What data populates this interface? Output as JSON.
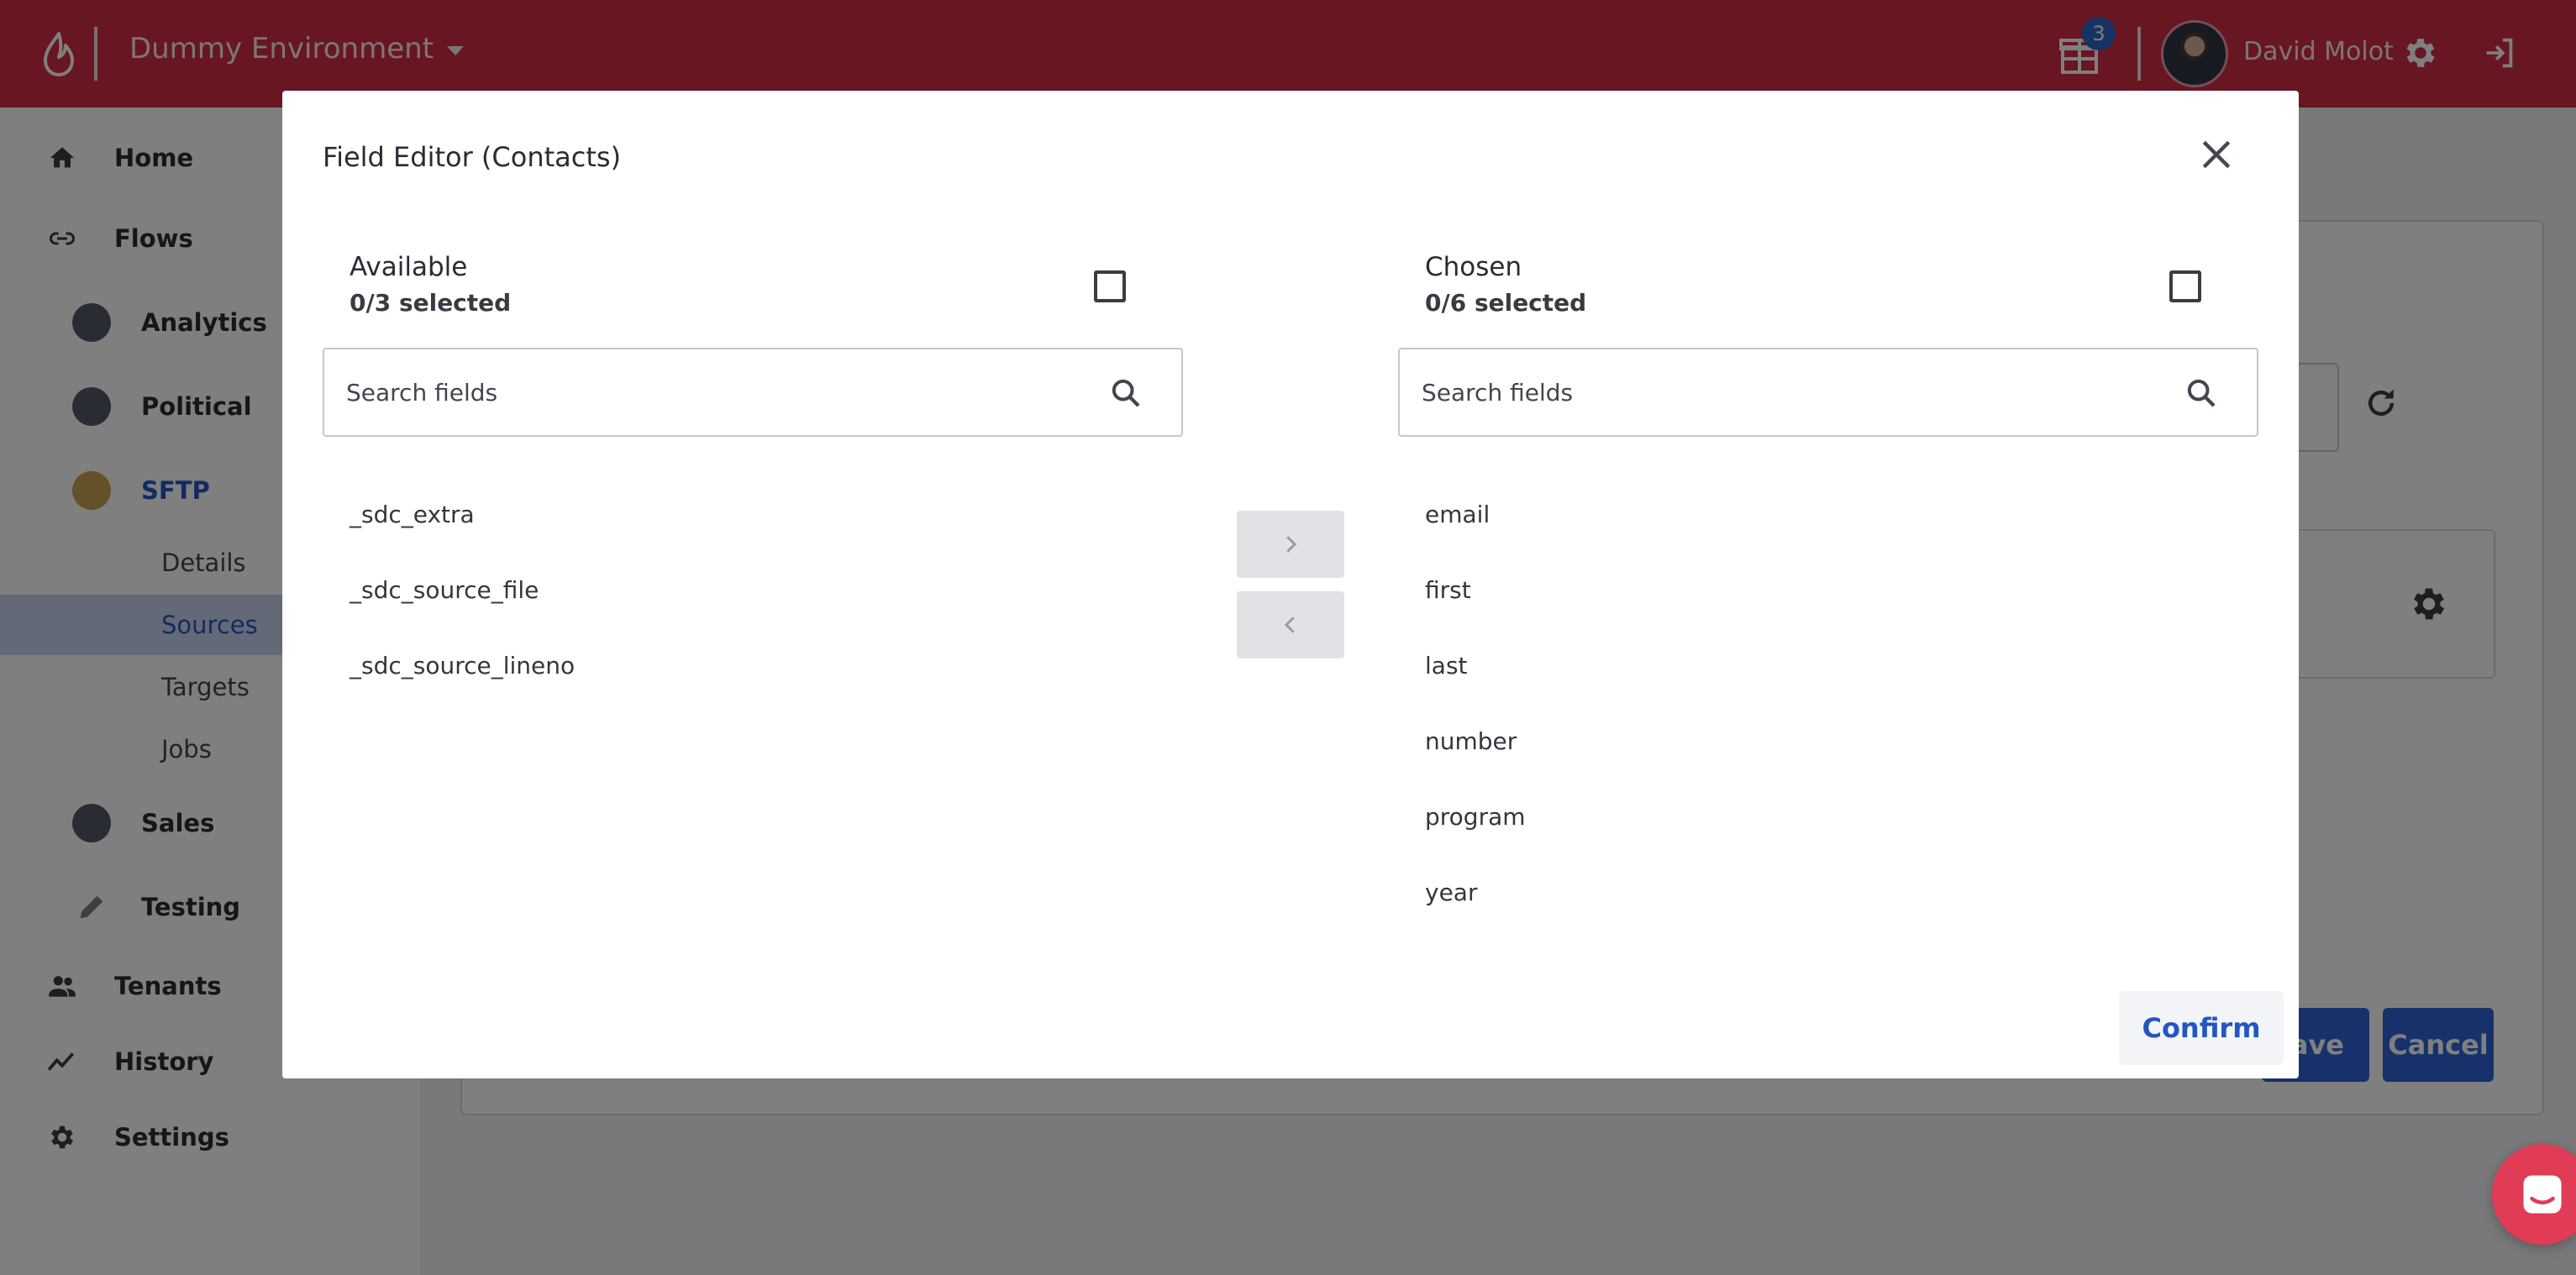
{
  "topbar": {
    "environment": "Dummy Environment",
    "notifications_count": "3",
    "user_name": "David Molot",
    "icons": [
      "flame-logo-icon",
      "gift-icon",
      "avatar",
      "gear-icon",
      "logout-icon"
    ]
  },
  "sidebar": {
    "items": [
      {
        "label": "Home",
        "icon": "home-icon"
      },
      {
        "label": "Flows",
        "icon": "link-icon"
      },
      {
        "label": "Analytics",
        "icon": "flow-avatar-icon"
      },
      {
        "label": "Political",
        "icon": "flow-avatar-icon"
      },
      {
        "label": "SFTP",
        "icon": "flow-avatar-icon"
      },
      {
        "label": "Details"
      },
      {
        "label": "Sources"
      },
      {
        "label": "Targets"
      },
      {
        "label": "Jobs"
      },
      {
        "label": "Sales",
        "icon": "flow-avatar-icon"
      },
      {
        "label": "Testing",
        "icon": "pencil-icon"
      },
      {
        "label": "Tenants",
        "icon": "people-icon"
      },
      {
        "label": "History",
        "icon": "trend-icon"
      },
      {
        "label": "Settings",
        "icon": "gear-icon"
      }
    ],
    "active": "Sources"
  },
  "background": {
    "save_label": "Save",
    "cancel_label": "Cancel"
  },
  "modal": {
    "title": "Field Editor (Contacts)",
    "available": {
      "title": "Available",
      "count": "0/3 selected",
      "search_placeholder": "Search fields",
      "fields": [
        "_sdc_extra",
        "_sdc_source_file",
        "_sdc_source_lineno"
      ]
    },
    "chosen": {
      "title": "Chosen",
      "count": "0/6 selected",
      "search_placeholder": "Search fields",
      "fields": [
        "email",
        "first",
        "last",
        "number",
        "program",
        "year"
      ]
    },
    "confirm_label": "Confirm"
  },
  "colors": {
    "brand": "#d12d45",
    "accent": "#2456c2",
    "overlay": "rgba(0,0,0,0.5)"
  }
}
